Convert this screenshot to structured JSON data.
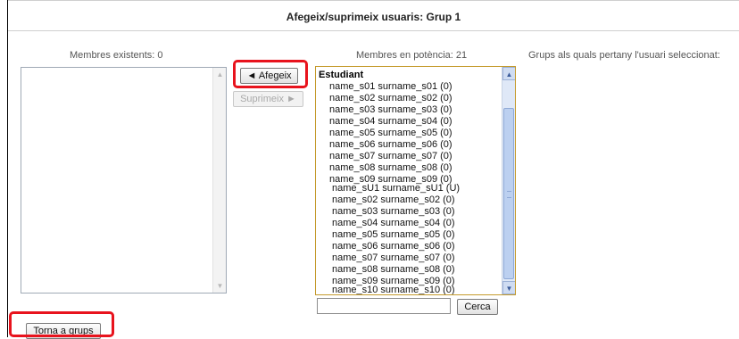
{
  "page": {
    "title": "Afegeix/suprimeix usuaris: Grup 1"
  },
  "columns": {
    "existing_heading": "Membres existents: 0",
    "potential_heading": "Membres en potència: 21",
    "groups_heading": "Grups als quals pertany l'usuari seleccionat:"
  },
  "buttons": {
    "add_label": "◄ Afegeix",
    "remove_label": "Suprimeix ►",
    "search_label": "Cerca",
    "back_label": "Torna a grups"
  },
  "potential": {
    "group_label": "Estudiant",
    "options": [
      "name_s01 surname_s01 (0)",
      "name_s02 surname_s02 (0)",
      "name_s03 surname_s03 (0)",
      "name_s04 surname_s04 (0)",
      "name_s05 surname_s05 (0)",
      "name_s06 surname_s06 (0)",
      "name_s07 surname_s07 (0)",
      "name_s08 surname_s08 (0)",
      "name_s09 surname_s09 (0)",
      "name_sU1 surname_sU1 (U)",
      "name_s02 surname_s02 (0)",
      "name_s03 surname_s03 (0)",
      "name_s04 surname_s04 (0)",
      "name_s05 surname_s05 (0)",
      "name_s06 surname_s06 (0)",
      "name_s07 surname_s07 (0)",
      "name_s08 surname_s08 (0)",
      "name_s09 surname_s09 (0)",
      "name_s10 surname_s10 (0)"
    ]
  },
  "search": {
    "value": ""
  },
  "icons": {
    "scroll_up": "▲",
    "scroll_down": "▼"
  }
}
